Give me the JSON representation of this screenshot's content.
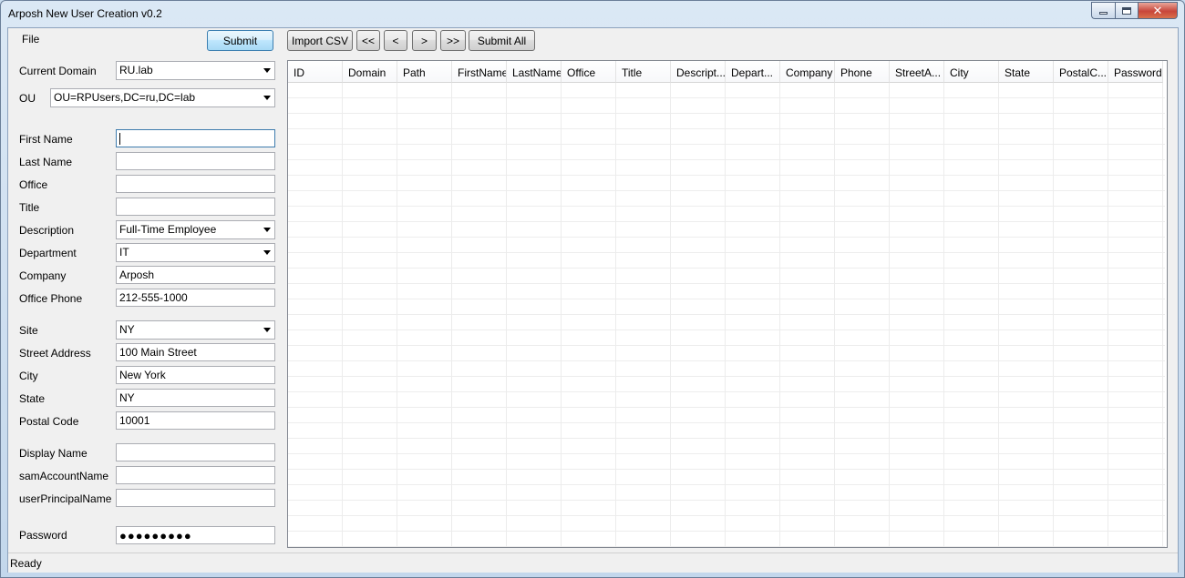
{
  "window": {
    "title": "Arposh New User Creation v0.2"
  },
  "menu": {
    "file": "File"
  },
  "toolbar": {
    "submit": "Submit",
    "import_csv": "Import CSV",
    "first": "<<",
    "prev": "<",
    "next": ">",
    "last": ">>",
    "submit_all": "Submit All"
  },
  "form": {
    "current_domain": {
      "label": "Current Domain",
      "value": "RU.lab"
    },
    "ou": {
      "label": "OU",
      "value": "OU=RPUsers,DC=ru,DC=lab"
    },
    "first_name": {
      "label": "First Name",
      "value": ""
    },
    "last_name": {
      "label": "Last Name",
      "value": ""
    },
    "office": {
      "label": "Office",
      "value": ""
    },
    "title": {
      "label": "Title",
      "value": ""
    },
    "description": {
      "label": "Description",
      "value": "Full-Time Employee"
    },
    "department": {
      "label": "Department",
      "value": "IT"
    },
    "company": {
      "label": "Company",
      "value": "Arposh"
    },
    "office_phone": {
      "label": "Office Phone",
      "value": "212-555-1000"
    },
    "site": {
      "label": "Site",
      "value": "NY"
    },
    "street_address": {
      "label": "Street Address",
      "value": "100 Main Street"
    },
    "city": {
      "label": "City",
      "value": "New York"
    },
    "state": {
      "label": "State",
      "value": "NY"
    },
    "postal_code": {
      "label": "Postal Code",
      "value": "10001"
    },
    "display_name": {
      "label": "Display Name",
      "value": ""
    },
    "sam_account_name": {
      "label": "samAccountName",
      "value": ""
    },
    "user_principal_name": {
      "label": "userPrincipalName",
      "value": ""
    },
    "password": {
      "label": "Password",
      "value": "●●●●●●●●●"
    }
  },
  "grid": {
    "columns": [
      "ID",
      "Domain",
      "Path",
      "FirstName",
      "LastName",
      "Office",
      "Title",
      "Descript...",
      "Depart...",
      "Company",
      "Phone",
      "StreetA...",
      "City",
      "State",
      "PostalC...",
      "Password"
    ]
  },
  "status": {
    "text": "Ready"
  }
}
